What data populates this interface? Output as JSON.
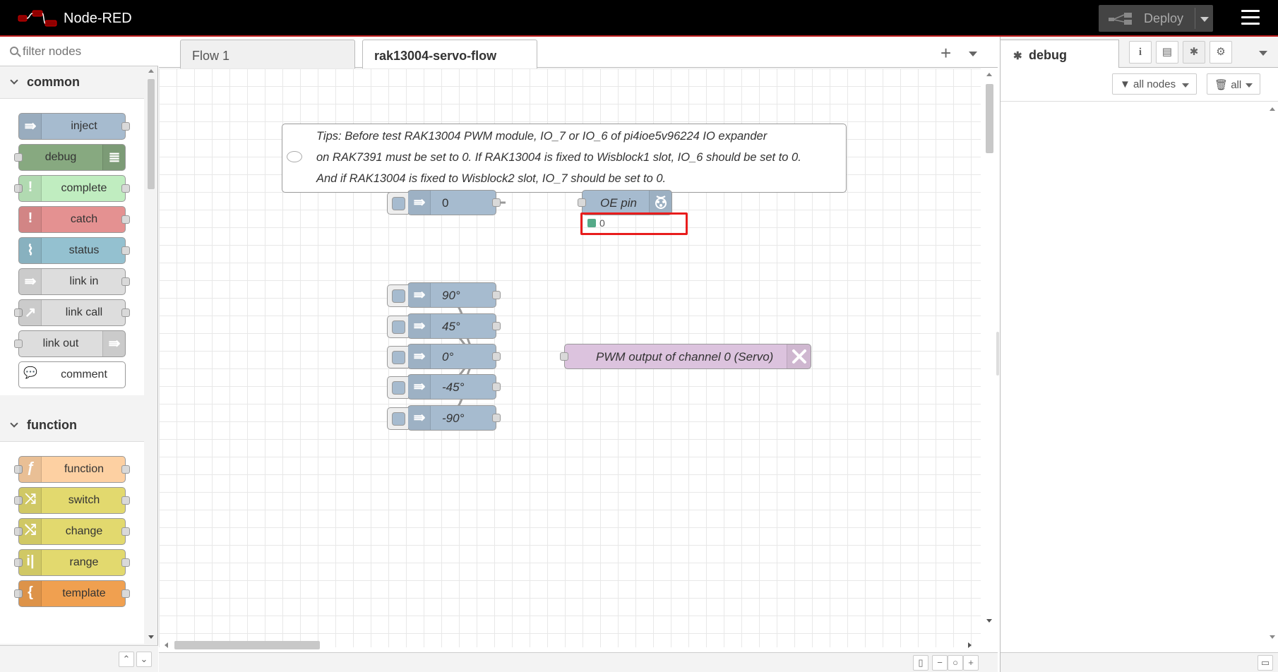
{
  "header": {
    "title": "Node-RED",
    "deploy_label": "Deploy"
  },
  "palette": {
    "filter_placeholder": "filter nodes",
    "categories": [
      {
        "label": "common",
        "nodes": [
          "inject",
          "debug",
          "complete",
          "catch",
          "status",
          "link in",
          "link call",
          "link out",
          "comment"
        ]
      },
      {
        "label": "function",
        "nodes": [
          "function",
          "switch",
          "change",
          "range",
          "template"
        ]
      }
    ]
  },
  "tabs": [
    {
      "label": "Flow 1"
    },
    {
      "label": "rak13004-servo-flow"
    }
  ],
  "flow": {
    "comment_lines": [
      "Tips: Before test RAK13004 PWM module, IO_7 or IO_6 of pi4ioe5v96224 IO expander",
      "on RAK7391 must be set to 0. If RAK13004 is fixed to Wisblock1 slot, IO_6 should be set to 0.",
      "And if RAK13004 is fixed to Wisblock2 slot, IO_7 should be set to 0."
    ],
    "inject_zero": "0",
    "oe_node": "OE pin",
    "oe_status": "0",
    "servo_injects": [
      "90°",
      "45°",
      "0°",
      "-45°",
      "-90°"
    ],
    "pwm_node": "PWM output of channel 0 (Servo)"
  },
  "sidebar": {
    "active_tab": "debug",
    "filter_nodes": "all nodes",
    "clear": "all"
  },
  "colors": {
    "inject": "#a6bbcf",
    "debug": "#87a980",
    "complete": "#c0edc0",
    "catch": "#e49191",
    "status": "#94c1d0",
    "link": "#dddddd",
    "function": "#fdd0a2",
    "switch": "#e2d96e",
    "pwm": "#dcc3de",
    "highlight": "#e81c1c"
  }
}
